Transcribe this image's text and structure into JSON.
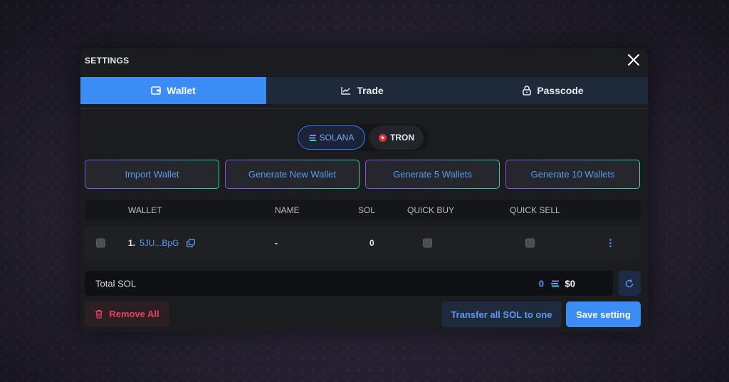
{
  "modal": {
    "title": "SETTINGS"
  },
  "tabs": [
    {
      "label": "Wallet",
      "icon": "wallet-icon",
      "active": true
    },
    {
      "label": "Trade",
      "icon": "chart-line-icon",
      "active": false
    },
    {
      "label": "Passcode",
      "icon": "lock-icon",
      "active": false
    }
  ],
  "chains": [
    {
      "label": "SOLANA",
      "icon": "solana-icon",
      "selected": true
    },
    {
      "label": "TRON",
      "icon": "tron-icon",
      "selected": false
    }
  ],
  "actions": {
    "import": "Import Wallet",
    "generate_new": "Generate New Wallet",
    "generate_5": "Generate 5 Wallets",
    "generate_10": "Generate 10 Wallets"
  },
  "table": {
    "columns": [
      "WALLET",
      "NAME",
      "SOL",
      "QUICK BUY",
      "QUICK SELL"
    ],
    "rows": [
      {
        "index": "1.",
        "address": "5JU...BpG",
        "name": "-",
        "sol": "0",
        "quick_buy": false,
        "quick_sell": false
      }
    ]
  },
  "total": {
    "label": "Total SOL",
    "sol": "0",
    "usd": "$0"
  },
  "footer": {
    "remove_all": "Remove All",
    "transfer_all": "Transfer all SOL to one",
    "save": "Save setting"
  },
  "colors": {
    "accent": "#3b8cf5",
    "danger": "#e0455b",
    "link": "#5a9bf0"
  }
}
